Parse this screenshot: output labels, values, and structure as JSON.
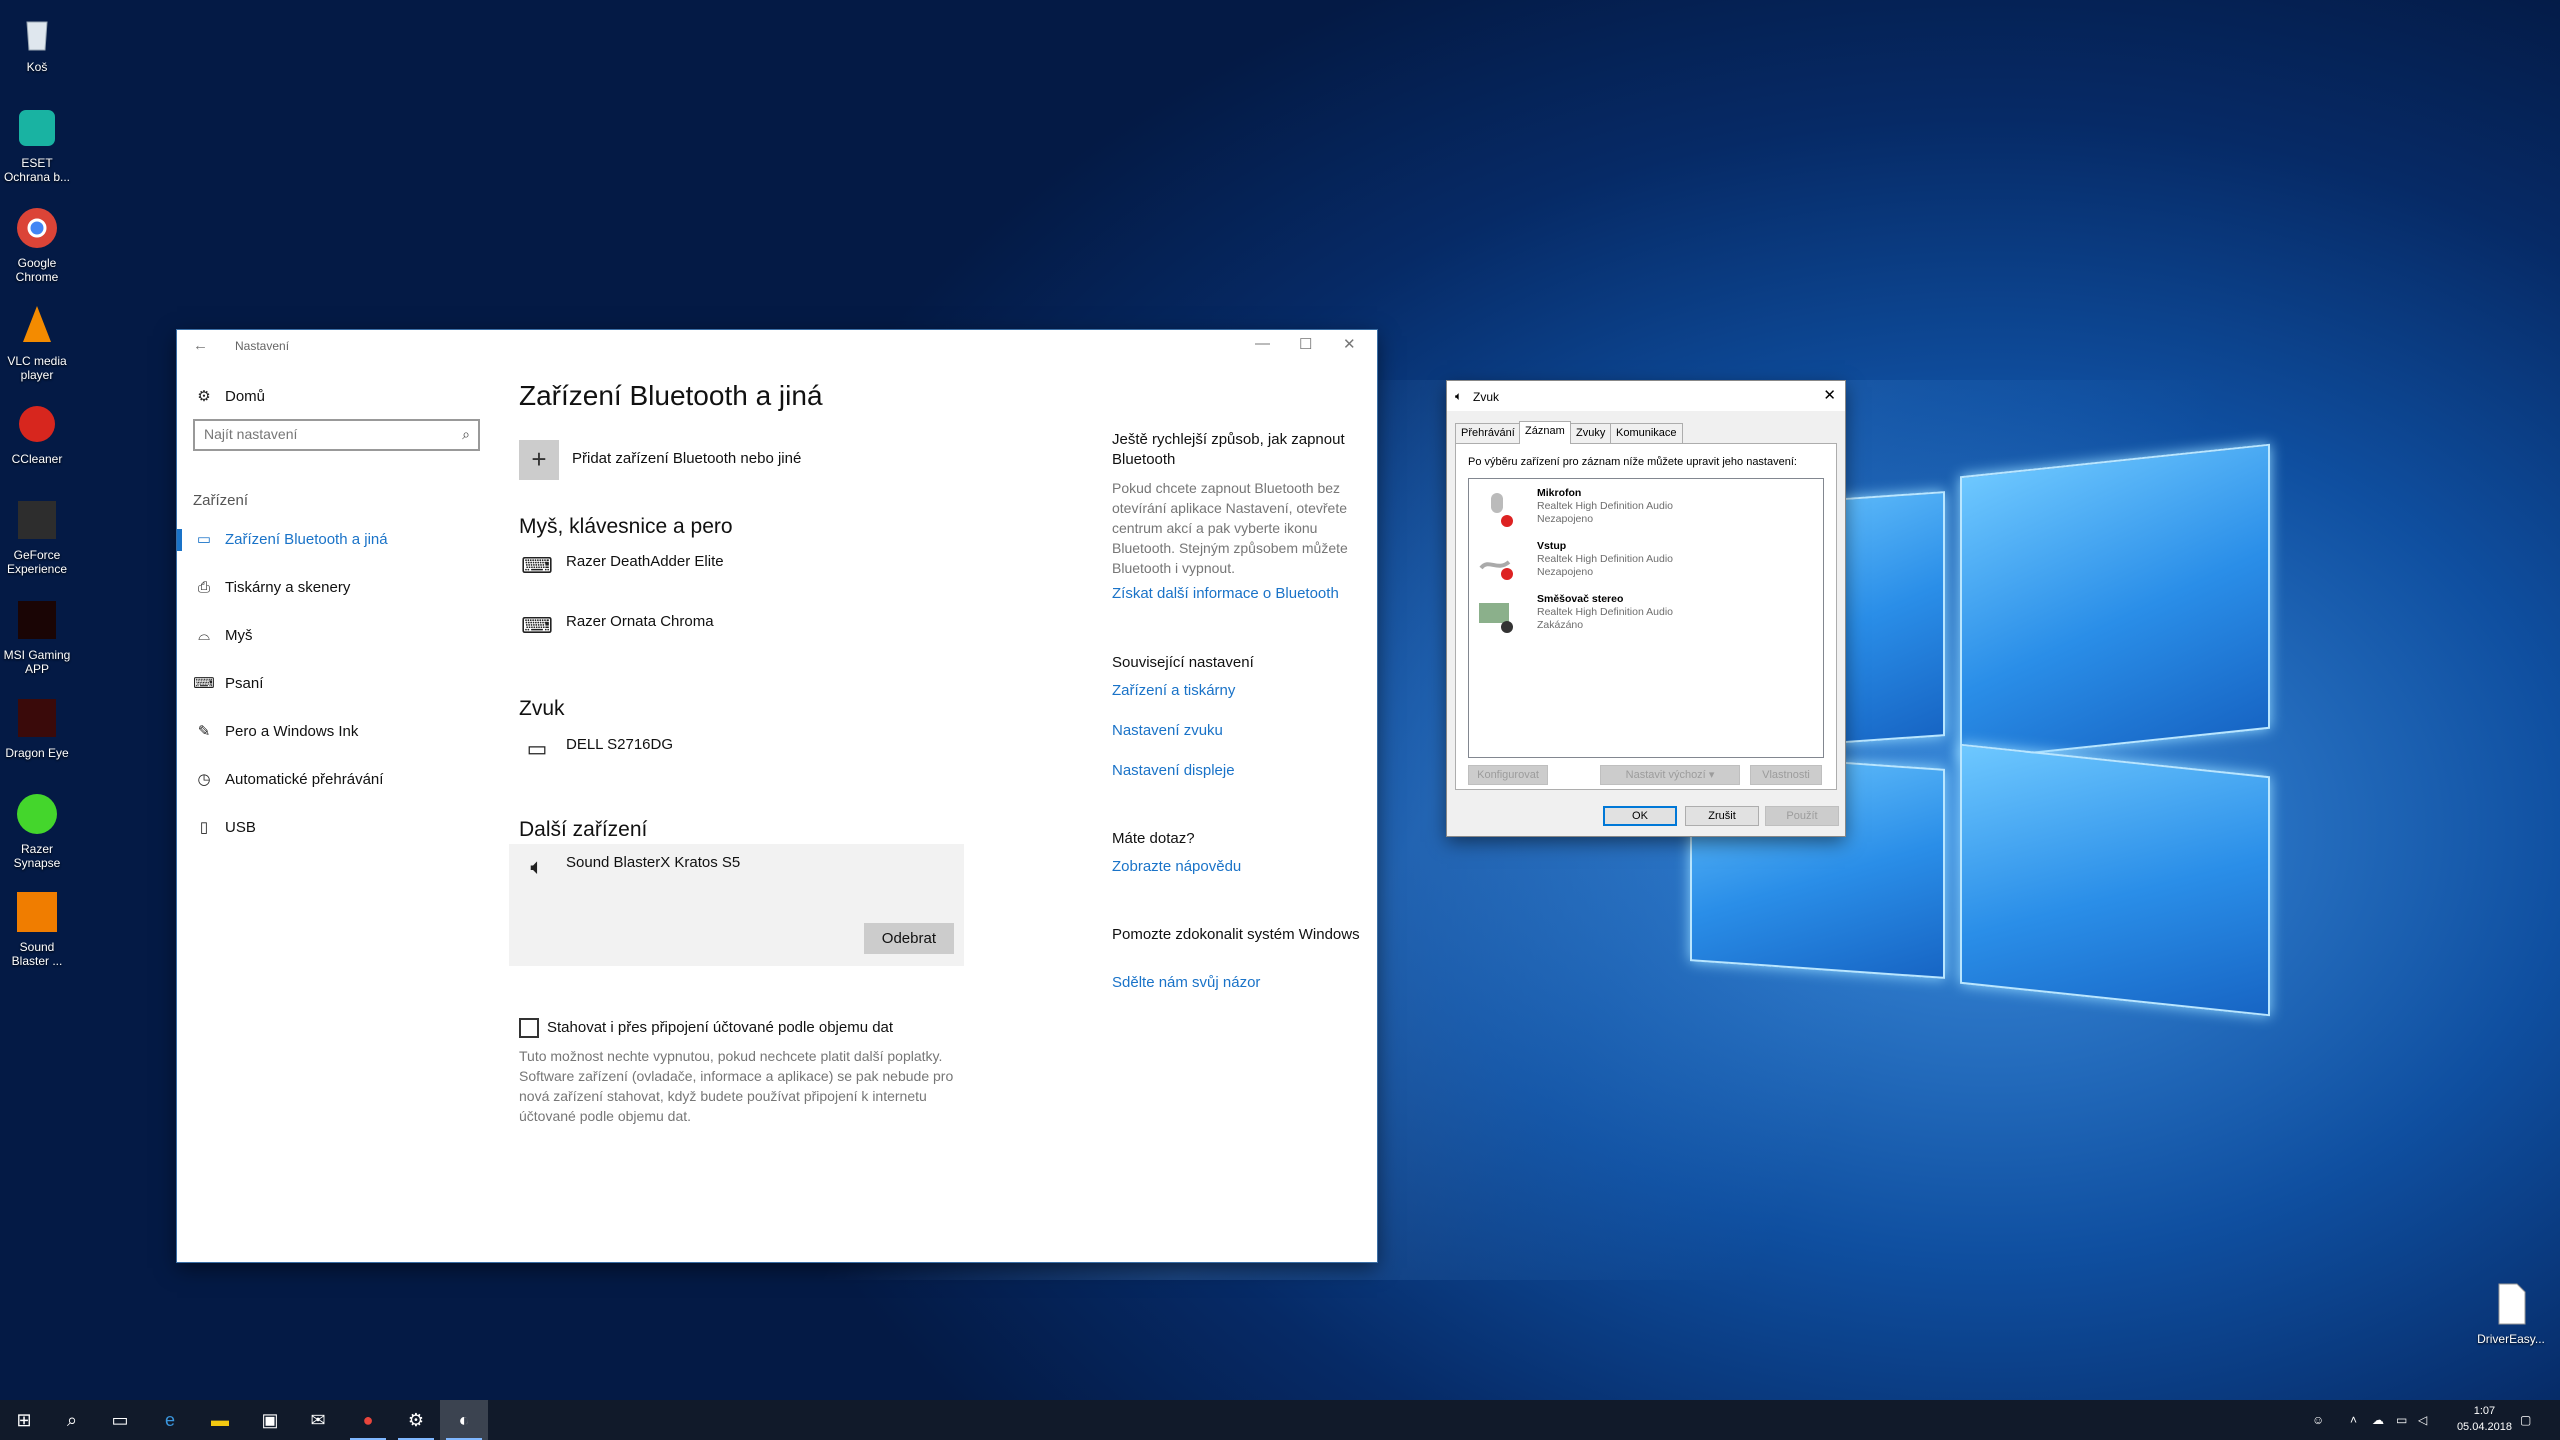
{
  "desktop": {
    "icons": [
      {
        "label": "Koš"
      },
      {
        "label": "ESET\nOchrana b..."
      },
      {
        "label": "Google\nChrome"
      },
      {
        "label": "VLC media\nplayer"
      },
      {
        "label": "CCleaner"
      },
      {
        "label": "GeForce\nExperience"
      },
      {
        "label": "MSI Gaming\nAPP"
      },
      {
        "label": "Dragon Eye"
      },
      {
        "label": "Razer\nSynapse"
      },
      {
        "label": "Sound\nBlaster ..."
      }
    ],
    "file_icon": {
      "label": "DriverEasy..."
    }
  },
  "settings": {
    "window_title": "Nastavení",
    "nav": {
      "home": "Domů",
      "search_placeholder": "Najít nastavení",
      "category": "Zařízení",
      "items": [
        {
          "label": "Zařízení Bluetooth a jiná",
          "icon": "bluetooth-icon",
          "selected": true
        },
        {
          "label": "Tiskárny a skenery",
          "icon": "printer-icon"
        },
        {
          "label": "Myš",
          "icon": "mouse-icon"
        },
        {
          "label": "Psaní",
          "icon": "keyboard-icon"
        },
        {
          "label": "Pero a Windows Ink",
          "icon": "pen-icon"
        },
        {
          "label": "Automatické přehrávání",
          "icon": "autoplay-icon"
        },
        {
          "label": "USB",
          "icon": "usb-icon"
        }
      ]
    },
    "page_title": "Zařízení Bluetooth a jiná",
    "add_device": "Přidat zařízení Bluetooth nebo jiné",
    "sections": {
      "input": {
        "title": "Myš, klávesnice a pero",
        "devices": [
          "Razer DeathAdder Elite",
          "Razer Ornata Chroma"
        ]
      },
      "audio": {
        "title": "Zvuk",
        "devices": [
          "DELL S2716DG"
        ]
      },
      "other": {
        "title": "Další zařízení",
        "devices": [
          "Sound BlasterX Kratos S5"
        ],
        "remove_button": "Odebrat"
      }
    },
    "metered": {
      "checkbox_label": "Stahovat i přes připojení účtované podle objemu dat",
      "checked": false,
      "description": "Tuto možnost nechte vypnutou, pokud nechcete platit další poplatky. Software zařízení (ovladače, informace a aplikace) se pak nebude pro nová zařízení stahovat, když budete používat připojení k internetu účtované podle objemu dat."
    },
    "right": {
      "quick_title": "Ještě rychlejší způsob, jak zapnout Bluetooth",
      "quick_desc": "Pokud chcete zapnout Bluetooth bez otevírání aplikace Nastavení, otevřete centrum akcí a pak vyberte ikonu Bluetooth. Stejným způsobem můžete Bluetooth i vypnout.",
      "quick_link": "Získat další informace o Bluetooth",
      "related_title": "Související nastavení",
      "related_links": [
        "Zařízení a tiskárny",
        "Nastavení zvuku",
        "Nastavení displeje"
      ],
      "help_title": "Máte dotaz?",
      "help_link": "Zobrazte nápovědu",
      "feedback_title": "Pomozte zdokonalit systém Windows",
      "feedback_link": "Sdělte nám svůj názor"
    }
  },
  "sound_dialog": {
    "title": "Zvuk",
    "tabs": [
      "Přehrávání",
      "Záznam",
      "Zvuky",
      "Komunikace"
    ],
    "active_tab": 1,
    "hint": "Po výběru zařízení pro záznam níže můžete upravit jeho nastavení:",
    "devices": [
      {
        "name": "Mikrofon",
        "driver": "Realtek High Definition Audio",
        "status": "Nezapojeno"
      },
      {
        "name": "Vstup",
        "driver": "Realtek High Definition Audio",
        "status": "Nezapojeno"
      },
      {
        "name": "Směšovač stereo",
        "driver": "Realtek High Definition Audio",
        "status": "Zakázáno"
      }
    ],
    "buttons": {
      "configure": "Konfigurovat",
      "set_default": "Nastavit výchozí",
      "properties": "Vlastnosti",
      "ok": "OK",
      "cancel": "Zrušit",
      "apply": "Použít"
    }
  },
  "taskbar": {
    "clock_time": "1:07",
    "clock_date": "05.04.2018"
  },
  "colors": {
    "accent": "#1a73c8",
    "taskbar": "#111a2a"
  }
}
